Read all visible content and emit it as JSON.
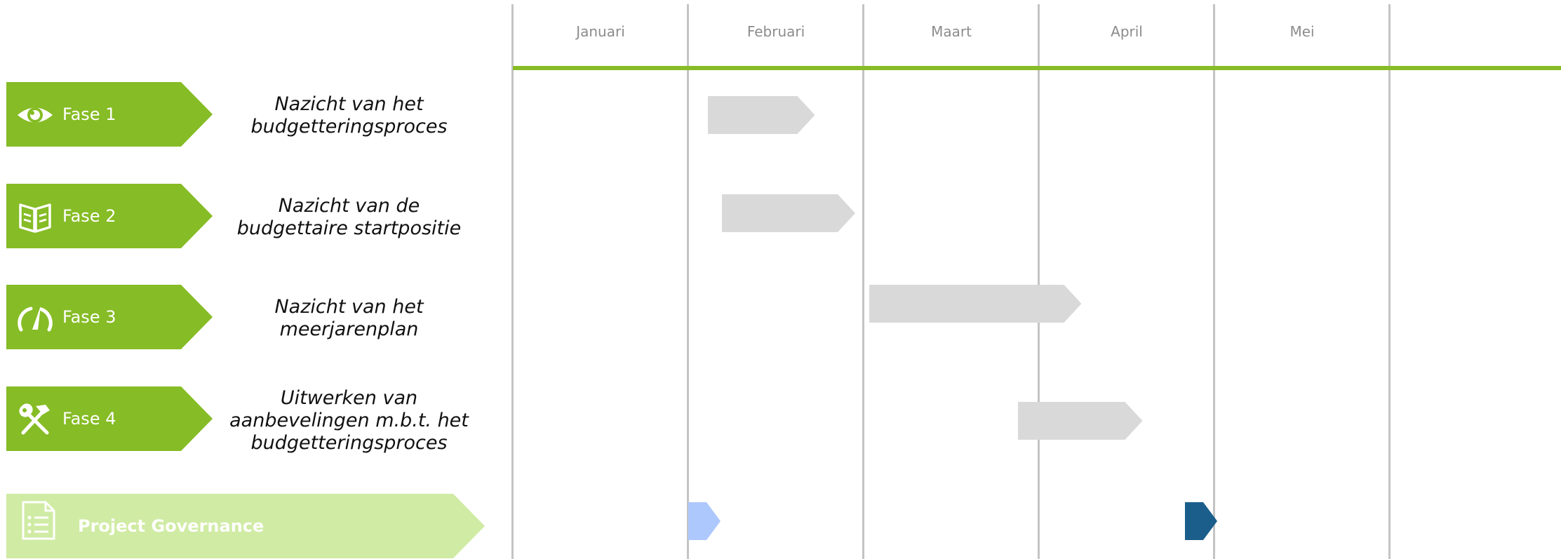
{
  "colors": {
    "phase_green": "#86bc25",
    "governance_light_green": "#d0eba4",
    "bar_grey": "#d9d9d9",
    "milestone_light_blue": "#adc8fd",
    "milestone_dark_blue": "#1b5e8c",
    "grid": "#c4c4c4",
    "month_text": "#8c8c8c"
  },
  "months": [
    "Januari",
    "Februari",
    "Maart",
    "April",
    "Mei"
  ],
  "phases": [
    {
      "label": "Fase 1",
      "icon": "eye-icon",
      "description": [
        "Nazicht van het",
        "budgetteringsproces"
      ]
    },
    {
      "label": "Fase 2",
      "icon": "open-book-icon",
      "description": [
        "Nazicht van de",
        "budgettaire startpositie"
      ]
    },
    {
      "label": "Fase 3",
      "icon": "speedometer-icon",
      "description": [
        "Nazicht van het",
        "meerjarenplan"
      ]
    },
    {
      "label": "Fase 4",
      "icon": "tools-icon",
      "description": [
        "Uitwerken van",
        "aanbevelingen m.b.t. het",
        "budgetteringsproces"
      ]
    }
  ],
  "governance": {
    "label": "Project Governance",
    "icon": "document-list-icon"
  },
  "timeline": {
    "bars": [
      {
        "phase": "Fase 1",
        "start_month": 1.11,
        "end_month": 1.72
      },
      {
        "phase": "Fase 2",
        "start_month": 1.19,
        "end_month": 1.95
      },
      {
        "phase": "Fase 3",
        "start_month": 2.03,
        "end_month": 3.24
      },
      {
        "phase": "Fase 4",
        "start_month": 2.88,
        "end_month": 3.59
      }
    ],
    "milestones": [
      {
        "month": 1.0,
        "color": "#adc8fd"
      },
      {
        "month": 3.83,
        "color": "#1b5e8c"
      }
    ]
  }
}
